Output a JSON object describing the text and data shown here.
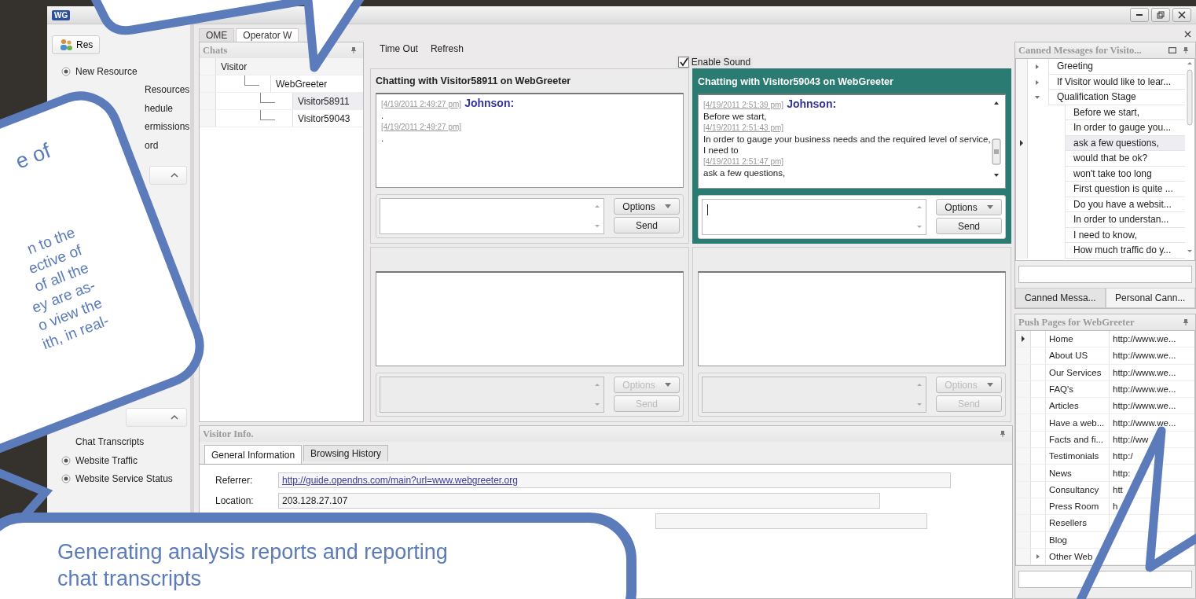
{
  "window": {
    "logo": "WG"
  },
  "sidebar": {
    "top_button": "Res",
    "items_1": [
      {
        "label": "New Resource",
        "kind": "radio"
      },
      {
        "label": "Resources",
        "kind": "partial"
      },
      {
        "label": "hedule",
        "kind": "partial"
      },
      {
        "label": "ermissions",
        "kind": "partial"
      },
      {
        "label": "ord",
        "kind": "partial"
      }
    ],
    "items_2": [
      {
        "label": "Chat Transcripts",
        "kind": "plain"
      },
      {
        "label": "Website Traffic",
        "kind": "radio"
      },
      {
        "label": "Website Service Status",
        "kind": "radio"
      }
    ]
  },
  "tabs": [
    {
      "label": "OME",
      "selected": false
    },
    {
      "label": "Operator W",
      "selected": true
    }
  ],
  "chats": {
    "title": "Chats",
    "column": "Visitor",
    "root": {
      "label": "WebGreeter",
      "selected": false,
      "children": [
        {
          "label": "Visitor58911",
          "selected": true
        },
        {
          "label": "Visitor59043",
          "selected": false
        }
      ]
    }
  },
  "toolbar": [
    "Time Out",
    "Refresh"
  ],
  "enable_sound": {
    "label": "Enable Sound",
    "checked": true
  },
  "panes": [
    {
      "title": "Chatting with Visitor58911 on WebGreeter",
      "active": false,
      "disabled": false,
      "messages": [
        {
          "time": "[4/19/2011 2:49:27 pm]",
          "author": "Johnson:",
          "text": "."
        },
        {
          "time": "[4/19/2011 2:49:27 pm]",
          "text": "."
        }
      ],
      "options": "Options",
      "send": "Send"
    },
    {
      "title": "Chatting with Visitor59043 on WebGreeter",
      "active": true,
      "disabled": false,
      "messages": [
        {
          "time": "[4/19/2011 2:51:39 pm]",
          "author": "Johnson:",
          "text": "Before we start,"
        },
        {
          "time": "[4/19/2011 2:51:43 pm]",
          "text": "In order to gauge your business needs and the required level of service, I need to"
        },
        {
          "time": "[4/19/2011 2:51:47 pm]",
          "text": "ask a few questions,"
        }
      ],
      "options": "Options",
      "send": "Send"
    },
    {
      "active": false,
      "disabled": true,
      "options": "Options",
      "send": "Send"
    },
    {
      "active": false,
      "disabled": true,
      "options": "Options",
      "send": "Send"
    }
  ],
  "visitor_info": {
    "title": "Visitor Info.",
    "tabs": [
      {
        "label": "General Information",
        "selected": true
      },
      {
        "label": "Browsing History",
        "selected": false
      }
    ],
    "fields": [
      {
        "kind": "link",
        "label": "Referrer:",
        "value": "http://guide.opendns.com/main?url=www.webgreeter.org"
      },
      {
        "kind": "text",
        "label": "Location:",
        "value": "203.128.27.107"
      },
      {
        "kind": "empty"
      }
    ]
  },
  "canned": {
    "title": "Canned Messages for Visito...",
    "groups": [
      {
        "label": "Greeting",
        "expanded": false
      },
      {
        "label": "If Visitor would like to lear...",
        "expanded": false
      },
      {
        "label": "Qualification Stage",
        "expanded": true,
        "children": [
          {
            "label": "Before we start,",
            "selected": false
          },
          {
            "label": "In order to gauge you...",
            "selected": false
          },
          {
            "label": "ask a few questions,",
            "selected": true
          },
          {
            "label": "would that be ok?",
            "selected": false
          },
          {
            "label": "won't take too long",
            "selected": false
          },
          {
            "label": "First question is quite ...",
            "selected": false
          },
          {
            "label": "Do you have a websit...",
            "selected": false
          },
          {
            "label": "In order to understan...",
            "selected": false
          },
          {
            "label": "I need to know,",
            "selected": false
          },
          {
            "label": "How much traffic do y...",
            "selected": false
          }
        ]
      }
    ],
    "tabs": [
      {
        "label": "Canned Messa...",
        "selected": true
      },
      {
        "label": "Personal Cann...",
        "selected": false
      }
    ]
  },
  "push_pages": {
    "title": "Push Pages for WebGreeter",
    "rows": [
      {
        "kind": "page",
        "name": "Home",
        "url": "http://www.we...",
        "selected": true
      },
      {
        "kind": "page",
        "name": "About US",
        "url": "http://www.we...",
        "selected": false
      },
      {
        "kind": "page",
        "name": "Our Services",
        "url": "http://www.we...",
        "selected": false
      },
      {
        "kind": "page",
        "name": "FAQ's",
        "url": "http://www.we...",
        "selected": false
      },
      {
        "kind": "page",
        "name": "Articles",
        "url": "http://www.we...",
        "selected": false
      },
      {
        "kind": "page",
        "name": "Have a web...",
        "url": "http://www.we...",
        "selected": false
      },
      {
        "kind": "page",
        "name": "Facts and fi...",
        "url": "http://ww",
        "selected": false
      },
      {
        "kind": "page",
        "name": "Testimonials",
        "url": "http:/",
        "selected": false
      },
      {
        "kind": "page",
        "name": "News",
        "url": "http:",
        "selected": false
      },
      {
        "kind": "page",
        "name": "Consultancy",
        "url": "htt",
        "selected": false
      },
      {
        "kind": "page",
        "name": "Press Room",
        "url": "h",
        "selected": false
      },
      {
        "kind": "page",
        "name": "Resellers",
        "selected": false
      },
      {
        "kind": "page",
        "name": "Blog",
        "selected": false
      },
      {
        "kind": "group",
        "name": "Other Web",
        "expanded": false,
        "selected": false
      }
    ]
  },
  "callouts": {
    "left_title": "e of",
    "left_lines": [
      "n to the",
      "ective of",
      "of all the",
      "ey are as-",
      "o view the",
      "ith, in real-"
    ],
    "bottom_lines": [
      "Generating analysis reports and reporting",
      "chat transcripts"
    ]
  }
}
